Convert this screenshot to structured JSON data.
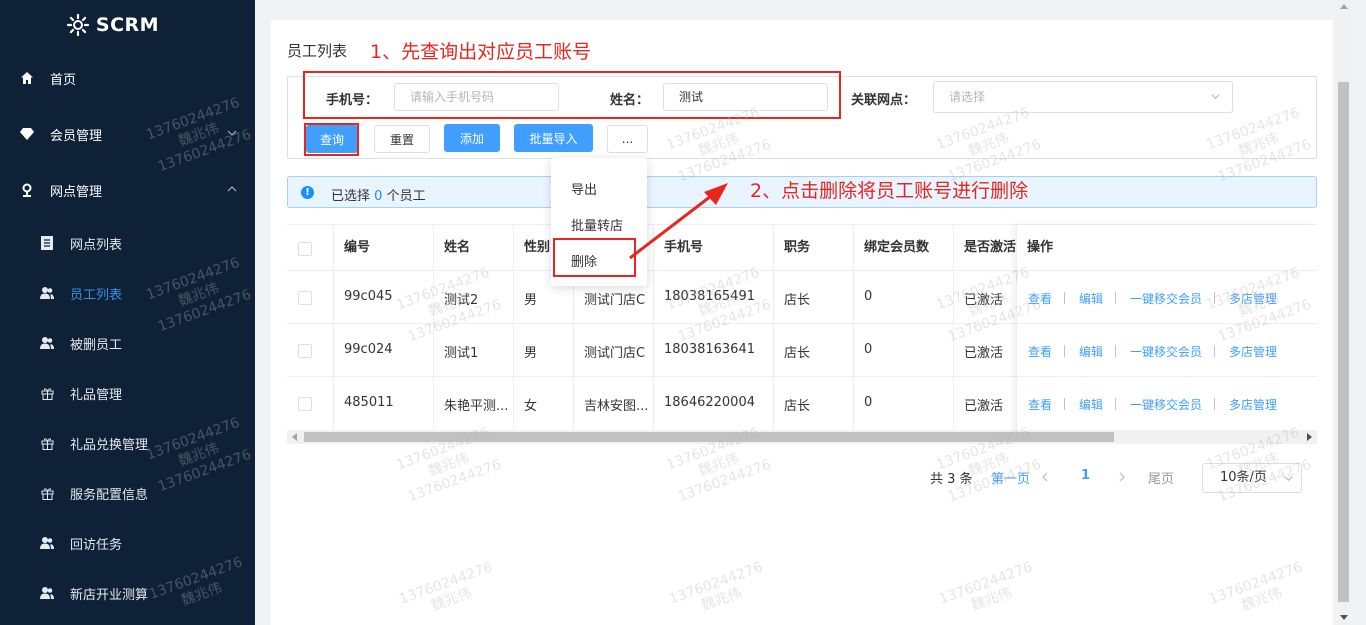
{
  "app": {
    "name": "SCRM"
  },
  "sidebar": {
    "items": [
      {
        "label": "首页",
        "icon": "home-icon"
      },
      {
        "label": "会员管理",
        "icon": "diamond-icon"
      },
      {
        "label": "网点管理",
        "icon": "location-pin-icon"
      },
      {
        "label": "网点列表",
        "icon": "document-icon"
      },
      {
        "label": "员工列表",
        "icon": "users-icon"
      },
      {
        "label": "被删员工",
        "icon": "users-icon"
      },
      {
        "label": "礼品管理",
        "icon": "gift-icon"
      },
      {
        "label": "礼品兑换管理",
        "icon": "gift-icon"
      },
      {
        "label": "服务配置信息",
        "icon": "gift-icon"
      },
      {
        "label": "回访任务",
        "icon": "users-icon"
      },
      {
        "label": "新店开业测算",
        "icon": "users-icon"
      }
    ],
    "active": "员工列表"
  },
  "page": {
    "title": "员工列表",
    "annotation_1": "1、先查询出对应员工账号",
    "annotation_2": "2、点击删除将员工账号进行删除"
  },
  "search": {
    "phone_label": "手机号：",
    "phone_placeholder": "请输入手机号码",
    "name_label": "姓名：",
    "name_value": "测试",
    "branch_label": "关联网点：",
    "branch_placeholder": "请选择"
  },
  "actions": {
    "query": "查询",
    "reset": "重置",
    "add": "添加",
    "batch_import": "批量导入",
    "more": "..."
  },
  "more_menu": {
    "export": "导出",
    "batch_transfer": "批量转店",
    "delete": "删除"
  },
  "selection": {
    "prefix": "已选择",
    "count": "0",
    "suffix": "个员工"
  },
  "table": {
    "headers": [
      "编号",
      "姓名",
      "性别",
      "手机号",
      "职务",
      "绑定会员数",
      "是否激活",
      "操作"
    ],
    "rows": [
      {
        "id": "99c045",
        "name": "测试2",
        "gender": "男",
        "store": "测试门店C",
        "phone": "18038165491",
        "position": "店长",
        "members": "0",
        "active": "已激活"
      },
      {
        "id": "99c024",
        "name": "测试1",
        "gender": "男",
        "store": "测试门店C",
        "phone": "18038163641",
        "position": "店长",
        "members": "0",
        "active": "已激活"
      },
      {
        "id": "485011",
        "name": "朱艳平测...",
        "gender": "女",
        "store": "吉林安图...",
        "phone": "18646220004",
        "position": "店长",
        "members": "0",
        "active": "已激活"
      }
    ],
    "ops": {
      "view": "查看",
      "edit": "编辑",
      "transfer": "一键移交会员",
      "multi_store": "多店管理"
    }
  },
  "pagination": {
    "total": "共 3 条",
    "first": "第一页",
    "current": "1",
    "last": "尾页",
    "page_size": "10条/页"
  },
  "watermark": {
    "phone": "13760244276",
    "name": "魏兆伟"
  },
  "colors": {
    "sidebar_bg": "#0f2137",
    "primary": "#409eff",
    "annotation": "#e8261f",
    "active_menu": "#3a8ee6"
  }
}
